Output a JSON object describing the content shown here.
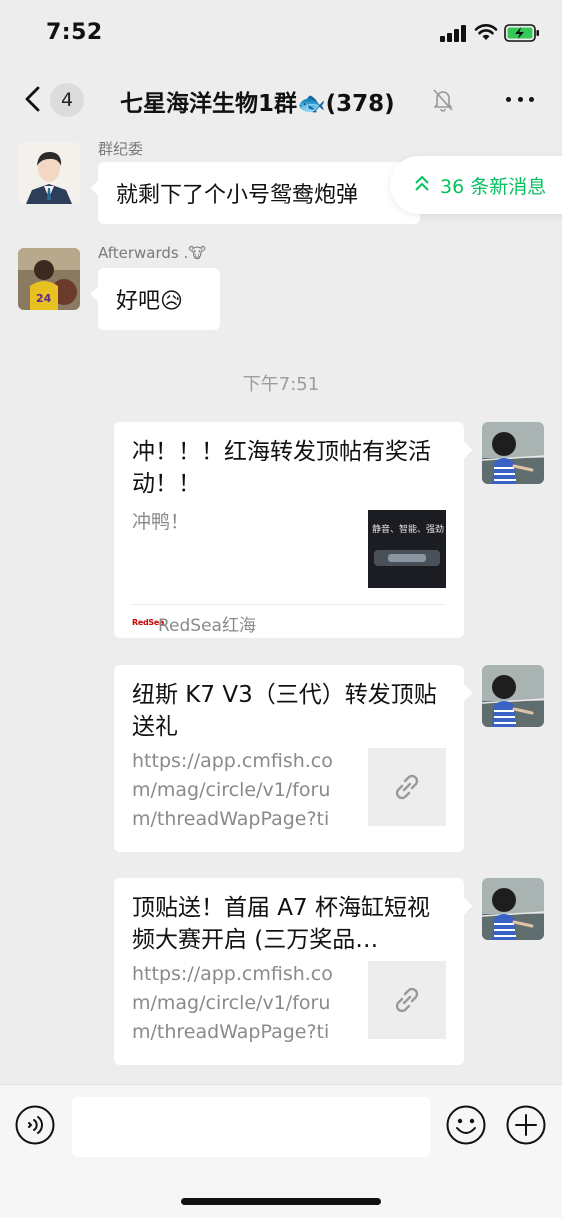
{
  "status_bar": {
    "time": "7:52",
    "icons": [
      "signal-icon",
      "wifi-icon",
      "battery-charging-icon"
    ]
  },
  "nav": {
    "unread_count": "4",
    "title": "七星海洋生物1群",
    "title_emoji": "🐟",
    "member_count": "(378)",
    "icons": [
      "back-chevron-icon",
      "mute-bell-icon",
      "more-dots-icon"
    ]
  },
  "new_messages": {
    "label": "36 条新消息",
    "icon": "double-chevron-up-icon"
  },
  "messages": [
    {
      "sender": "群纪委",
      "text": "就剩下了个小号鸳鸯炮弹"
    },
    {
      "sender": "Afterwards .🐮",
      "text": "好吧😥"
    }
  ],
  "time_divider": "下午7:51",
  "cards": [
    {
      "title": "冲！！！红海转发顶帖有奖活动！！",
      "desc": "冲鸭！",
      "thumb_caption": "静音、智能、强劲",
      "source_logo": "RedSea",
      "source_name": "RedSea红海"
    },
    {
      "title": "纽斯 K7 V3（三代）转发顶贴送礼",
      "desc": "https://app.cmfish.com/mag/circle/v1/forum/threadWapPage?tid…"
    },
    {
      "title": "顶贴送！首届 A7 杯海缸短视频大赛开启 (三万奖品…",
      "desc": "https://app.cmfish.com/mag/circle/v1/forum/threadWapPage?tid…"
    }
  ],
  "colors": {
    "accent": "#07c160",
    "background": "#ededed",
    "bubble": "#ffffff",
    "muted_text": "#8a8a8a"
  },
  "input_bar": {
    "icons": [
      "voice-icon",
      "emoji-icon",
      "plus-icon"
    ]
  }
}
